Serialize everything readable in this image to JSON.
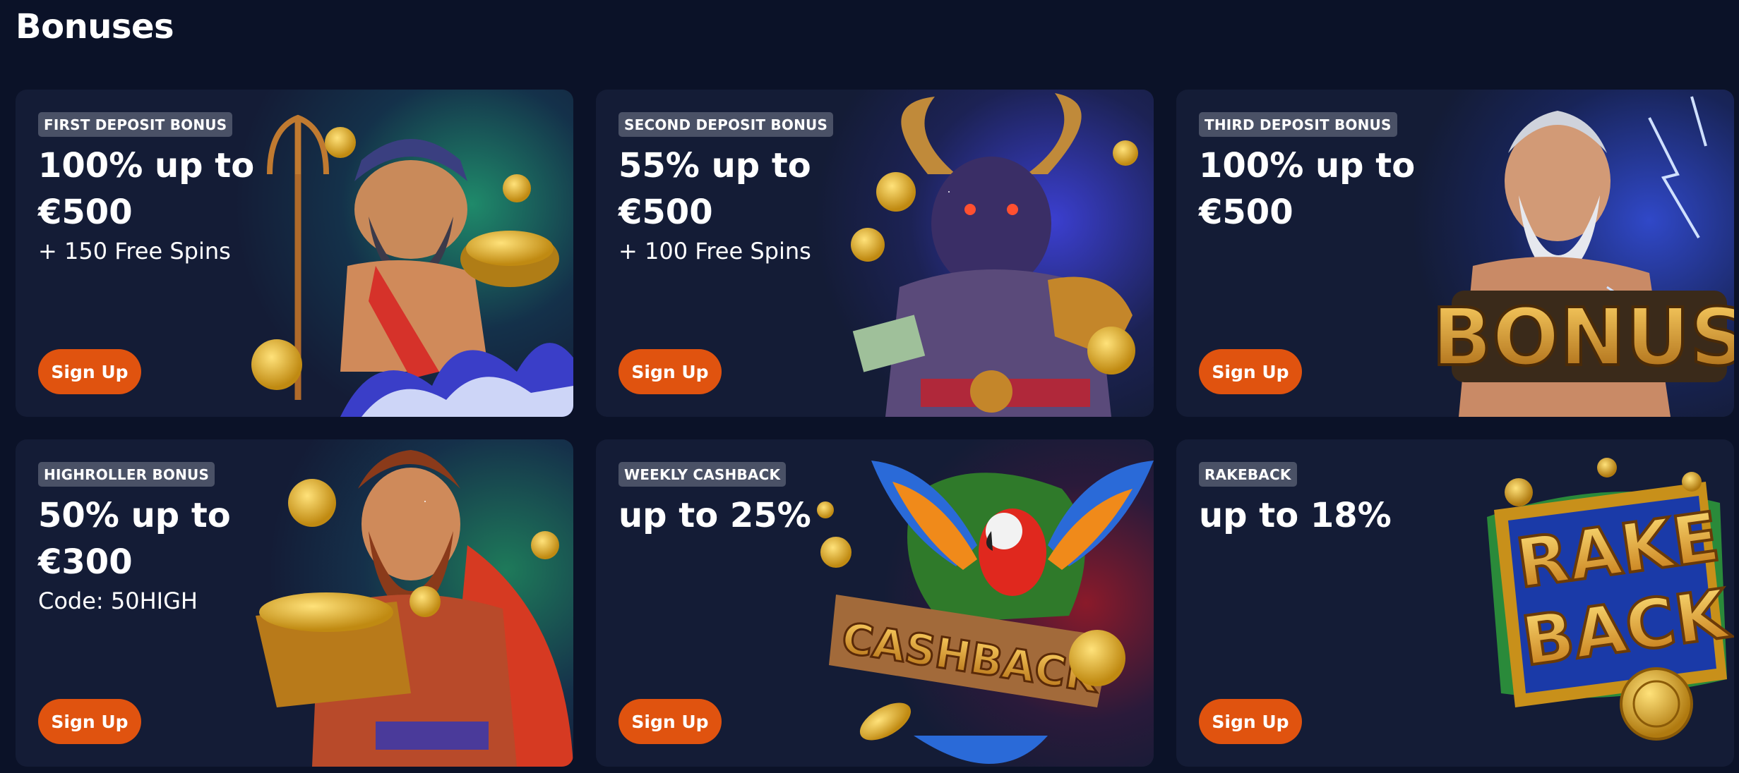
{
  "page": {
    "title": "Bonuses"
  },
  "colors": {
    "background": "#0b1228",
    "card": "#141c36",
    "badge": "#4a5166",
    "button": "#e0530f"
  },
  "cards": [
    {
      "badge": "FIRST DEPOSIT BONUS",
      "headline": "100% up to €500",
      "subline": "+ 150 Free Spins",
      "button": "Sign Up",
      "art": "sea-god-with-trident-and-gold-pot"
    },
    {
      "badge": "SECOND DEPOSIT BONUS",
      "headline": "55% up to €500",
      "subline": "+ 100 Free Spins",
      "button": "Sign Up",
      "art": "minotaur-with-cash"
    },
    {
      "badge": "THIRD DEPOSIT BONUS",
      "headline": "100% up to €500",
      "subline": "",
      "button": "Sign Up",
      "art": "lightning-god-with-sign",
      "art_text": "BONUS"
    },
    {
      "badge": "HIGHROLLER BONUS",
      "headline": "50% up to €300",
      "subline": "Code: 50HIGH",
      "button": "Sign Up",
      "art": "warrior-with-treasure-chest"
    },
    {
      "badge": "WEEKLY CASHBACK",
      "headline": "up to 25%",
      "subline": "",
      "button": "Sign Up",
      "art": "parrot-with-sign",
      "art_text": "CASHBACK"
    },
    {
      "badge": "RAKEBACK",
      "headline": "up to 18%",
      "subline": "",
      "button": "Sign Up",
      "art": "rakeback-logo",
      "art_text": [
        "RAKE",
        "BACK"
      ]
    }
  ]
}
